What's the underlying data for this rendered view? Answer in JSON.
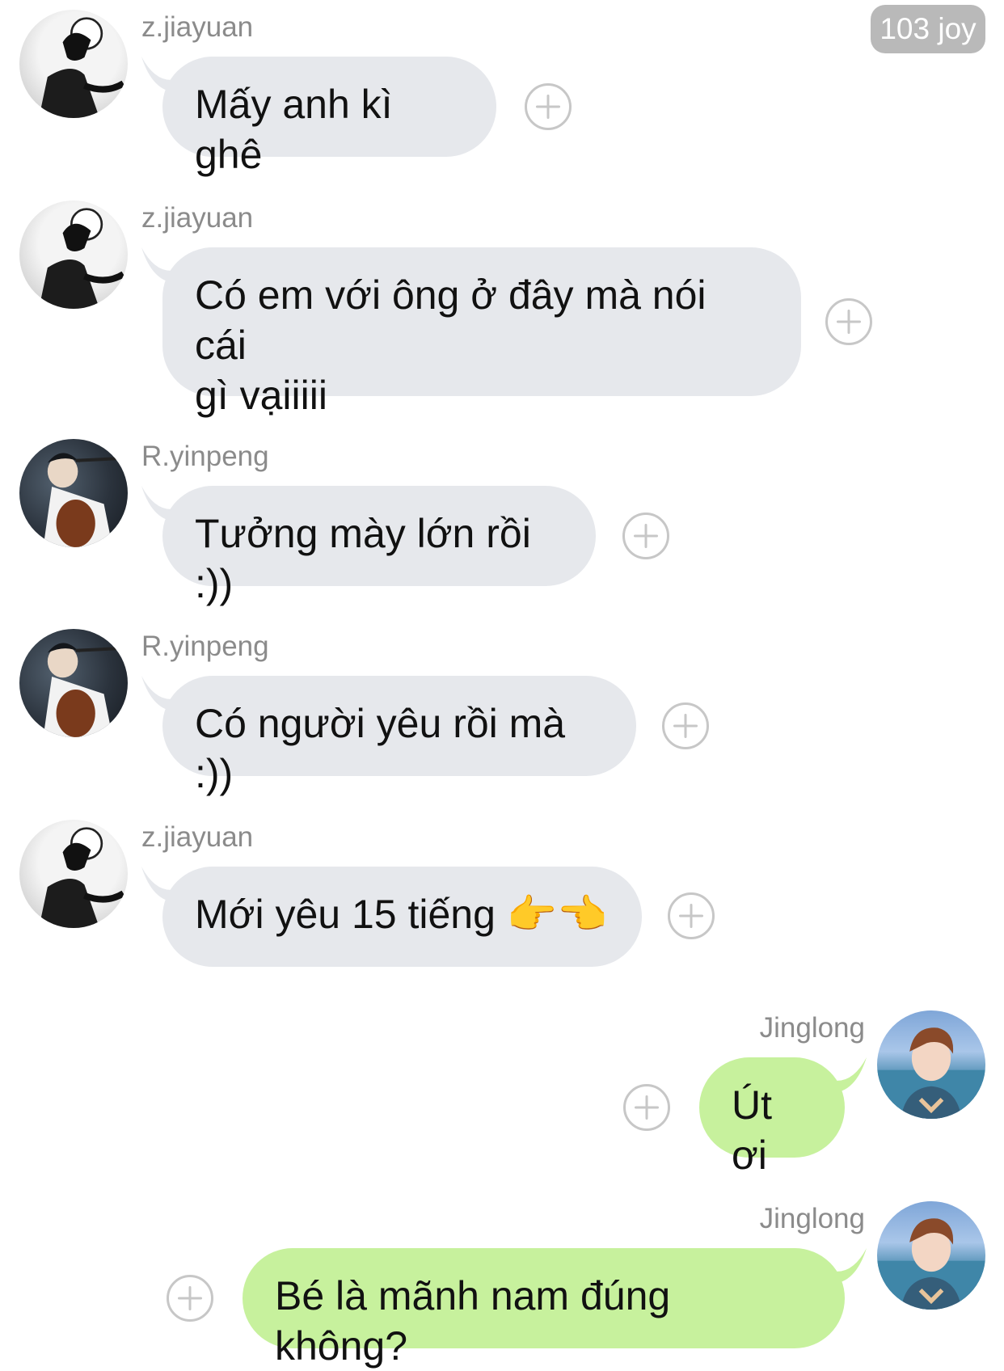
{
  "header": {
    "badge_text": "103 joy"
  },
  "messages": [
    {
      "sender": "z.jiayuan",
      "text": "Mấy anh kì ghê",
      "side": "left",
      "avatar": "avatar-z-jiayuan"
    },
    {
      "sender": "z.jiayuan",
      "text": "Có em với ông ở đây mà nói cái\ngì vạiiiii",
      "side": "left",
      "avatar": "avatar-z-jiayuan"
    },
    {
      "sender": "R.yinpeng",
      "text": "Tưởng mày lớn rồi :))",
      "side": "left",
      "avatar": "avatar-r-yinpeng"
    },
    {
      "sender": "R.yinpeng",
      "text": "Có người yêu rồi mà :))",
      "side": "left",
      "avatar": "avatar-r-yinpeng"
    },
    {
      "sender": "z.jiayuan",
      "text": "Mới yêu 15 tiếng 👉👈",
      "side": "left",
      "avatar": "avatar-z-jiayuan"
    },
    {
      "sender": "Jinglong",
      "text": "Út ơi",
      "side": "right",
      "avatar": "avatar-jinglong"
    },
    {
      "sender": "Jinglong",
      "text": "Bé là mãnh nam đúng không?",
      "side": "right",
      "avatar": "avatar-jinglong"
    }
  ],
  "icons": {
    "reaction": "add-reaction-icon"
  },
  "colors": {
    "incoming_bubble": "#e6e8ec",
    "outgoing_bubble": "#c7f19d",
    "badge": "#b9b9b9"
  }
}
